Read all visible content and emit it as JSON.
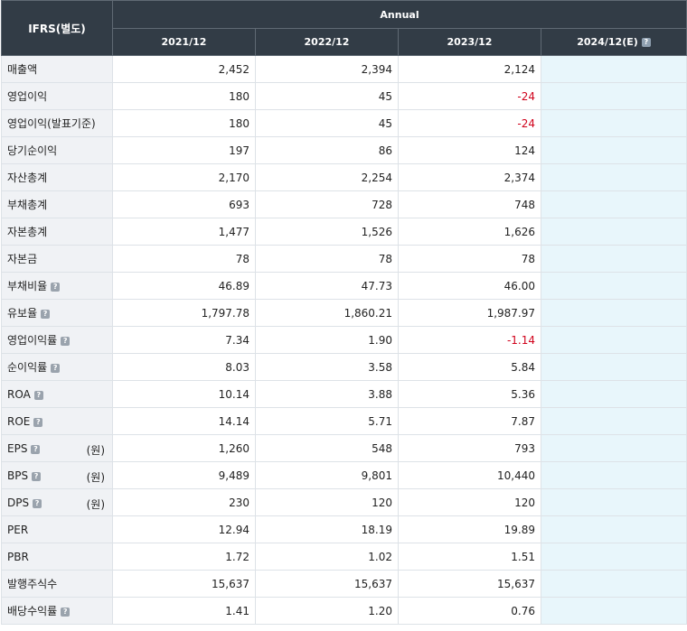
{
  "header": {
    "corner_label": "IFRS(별도)",
    "group_label": "Annual",
    "columns": [
      "2021/12",
      "2022/12",
      "2023/12",
      "2024/12(E)"
    ],
    "help_glyph": "?"
  },
  "rows": [
    {
      "label": "매출액",
      "help": false,
      "unit": "",
      "values": [
        "2,452",
        "2,394",
        "2,124",
        ""
      ]
    },
    {
      "label": "영업이익",
      "help": false,
      "unit": "",
      "values": [
        "180",
        "45",
        "-24",
        ""
      ]
    },
    {
      "label": "영업이익(발표기준)",
      "help": false,
      "unit": "",
      "values": [
        "180",
        "45",
        "-24",
        ""
      ]
    },
    {
      "label": "당기순이익",
      "help": false,
      "unit": "",
      "values": [
        "197",
        "86",
        "124",
        ""
      ]
    },
    {
      "label": "자산총계",
      "help": false,
      "unit": "",
      "values": [
        "2,170",
        "2,254",
        "2,374",
        ""
      ]
    },
    {
      "label": "부채총계",
      "help": false,
      "unit": "",
      "values": [
        "693",
        "728",
        "748",
        ""
      ]
    },
    {
      "label": "자본총계",
      "help": false,
      "unit": "",
      "values": [
        "1,477",
        "1,526",
        "1,626",
        ""
      ]
    },
    {
      "label": "자본금",
      "help": false,
      "unit": "",
      "values": [
        "78",
        "78",
        "78",
        ""
      ]
    },
    {
      "label": "부채비율",
      "help": true,
      "unit": "",
      "values": [
        "46.89",
        "47.73",
        "46.00",
        ""
      ]
    },
    {
      "label": "유보율",
      "help": true,
      "unit": "",
      "values": [
        "1,797.78",
        "1,860.21",
        "1,987.97",
        ""
      ]
    },
    {
      "label": "영업이익률",
      "help": true,
      "unit": "",
      "values": [
        "7.34",
        "1.90",
        "-1.14",
        ""
      ]
    },
    {
      "label": "순이익률",
      "help": true,
      "unit": "",
      "values": [
        "8.03",
        "3.58",
        "5.84",
        ""
      ]
    },
    {
      "label": "ROA",
      "help": true,
      "unit": "",
      "values": [
        "10.14",
        "3.88",
        "5.36",
        ""
      ]
    },
    {
      "label": "ROE",
      "help": true,
      "unit": "",
      "values": [
        "14.14",
        "5.71",
        "7.87",
        ""
      ]
    },
    {
      "label": "EPS",
      "help": true,
      "unit": "(원)",
      "values": [
        "1,260",
        "548",
        "793",
        ""
      ]
    },
    {
      "label": "BPS",
      "help": true,
      "unit": "(원)",
      "values": [
        "9,489",
        "9,801",
        "10,440",
        ""
      ]
    },
    {
      "label": "DPS",
      "help": true,
      "unit": "(원)",
      "values": [
        "230",
        "120",
        "120",
        ""
      ]
    },
    {
      "label": "PER",
      "help": false,
      "unit": "",
      "values": [
        "12.94",
        "18.19",
        "19.89",
        ""
      ]
    },
    {
      "label": "PBR",
      "help": false,
      "unit": "",
      "values": [
        "1.72",
        "1.02",
        "1.51",
        ""
      ]
    },
    {
      "label": "발행주식수",
      "help": false,
      "unit": "",
      "values": [
        "15,637",
        "15,637",
        "15,637",
        ""
      ]
    },
    {
      "label": "배당수익률",
      "help": true,
      "unit": "",
      "values": [
        "1.41",
        "1.20",
        "0.76",
        ""
      ]
    }
  ],
  "colors": {
    "header_bg": "#323c46",
    "label_bg": "#f0f2f5",
    "estimate_bg": "#e8f6fb",
    "negative": "#d0021b"
  }
}
